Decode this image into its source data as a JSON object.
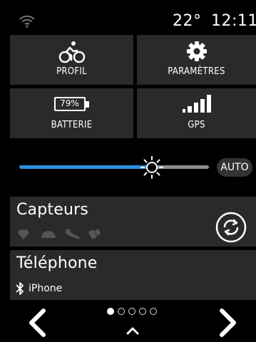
{
  "status_bar": {
    "wifi_icon": "wifi-icon",
    "temperature": "22°",
    "time": "12:11"
  },
  "tiles": [
    {
      "icon": "cyclist-icon",
      "label": "PROFIL"
    },
    {
      "icon": "gear-icon",
      "label": "PARAMÈTRES"
    },
    {
      "icon": "battery-icon",
      "label": "BATTERIE",
      "battery_text": "79%"
    },
    {
      "icon": "signal-bars-icon",
      "label": "GPS"
    }
  ],
  "brightness": {
    "level": 0.7,
    "auto_label": "AUTO",
    "accent_color": "#2f8fe0"
  },
  "sensors": {
    "title": "Capteurs",
    "icons": [
      "heart-icon",
      "speedometer-icon",
      "wrench-icon",
      "sensor-pod-icon"
    ],
    "sync_icon": "sync-icon"
  },
  "phone": {
    "title": "Téléphone",
    "device": "iPhone",
    "bluetooth_icon": "bluetooth-icon"
  },
  "navigation": {
    "page_count": 5,
    "current_page": 1
  }
}
